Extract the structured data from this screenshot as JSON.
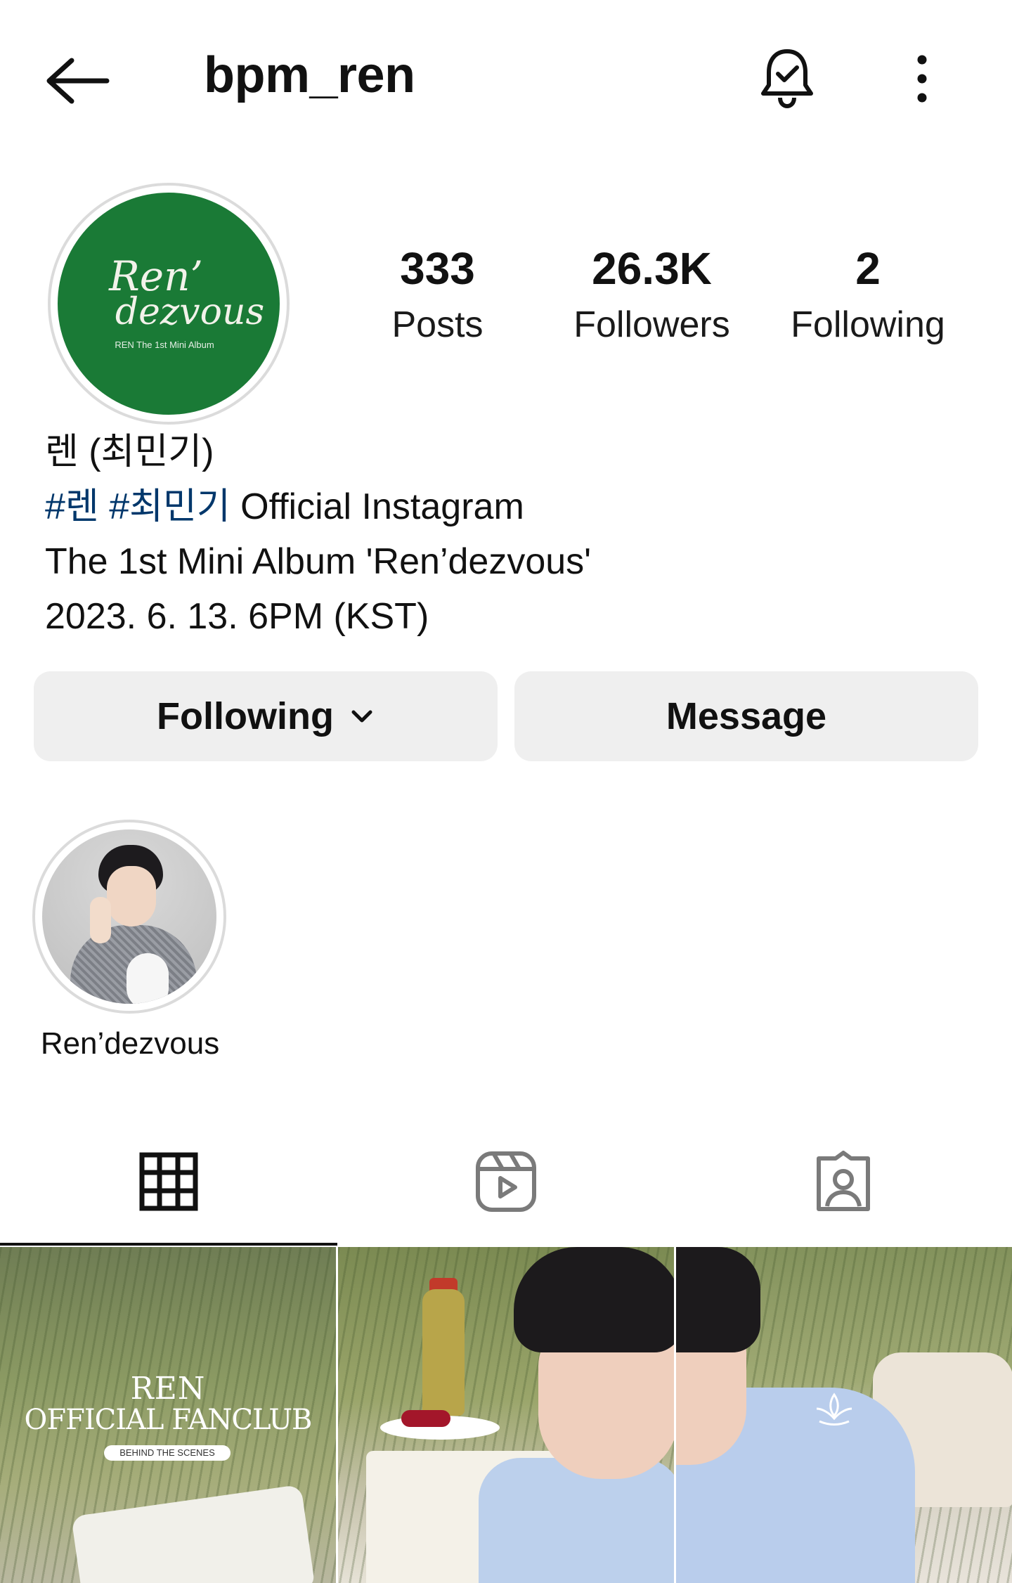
{
  "header": {
    "username": "bpm_ren",
    "icons": [
      "arrow-left-icon",
      "bell-check-icon",
      "more-vertical-icon"
    ]
  },
  "profile": {
    "avatar_text": {
      "line1": "Ren’",
      "line2": "dezvous",
      "sub": "REN The 1st Mini Album"
    },
    "stats": {
      "posts": {
        "value": "333",
        "label": "Posts"
      },
      "followers": {
        "value": "26.3K",
        "label": "Followers"
      },
      "following": {
        "value": "2",
        "label": "Following"
      }
    },
    "bio": {
      "name": "렌 (최민기)",
      "hashtag1": "#렌",
      "hashtag2": "#최민기",
      "line2_rest": " Official Instagram",
      "line3": "The 1st Mini Album 'Ren’dezvous'",
      "line4": "2023. 6. 13. 6PM (KST)"
    }
  },
  "actions": {
    "following_label": "Following",
    "message_label": "Message"
  },
  "highlights": [
    {
      "label": "Ren’dezvous"
    }
  ],
  "tabs": [
    {
      "name": "posts-grid",
      "icon": "grid-icon",
      "active": true
    },
    {
      "name": "reels",
      "icon": "reels-icon",
      "active": false
    },
    {
      "name": "tagged",
      "icon": "tagged-person-icon",
      "active": false
    }
  ],
  "posts": [
    {
      "overlay_title": "REN",
      "overlay_subtitle": "OFFICIAL FANCLUB",
      "overlay_pill": "BEHIND THE SCENES"
    },
    {},
    {}
  ],
  "colors": {
    "hashtag": "#00376b",
    "button_bg": "#efefef",
    "avatar_green": "#1a7a36"
  }
}
